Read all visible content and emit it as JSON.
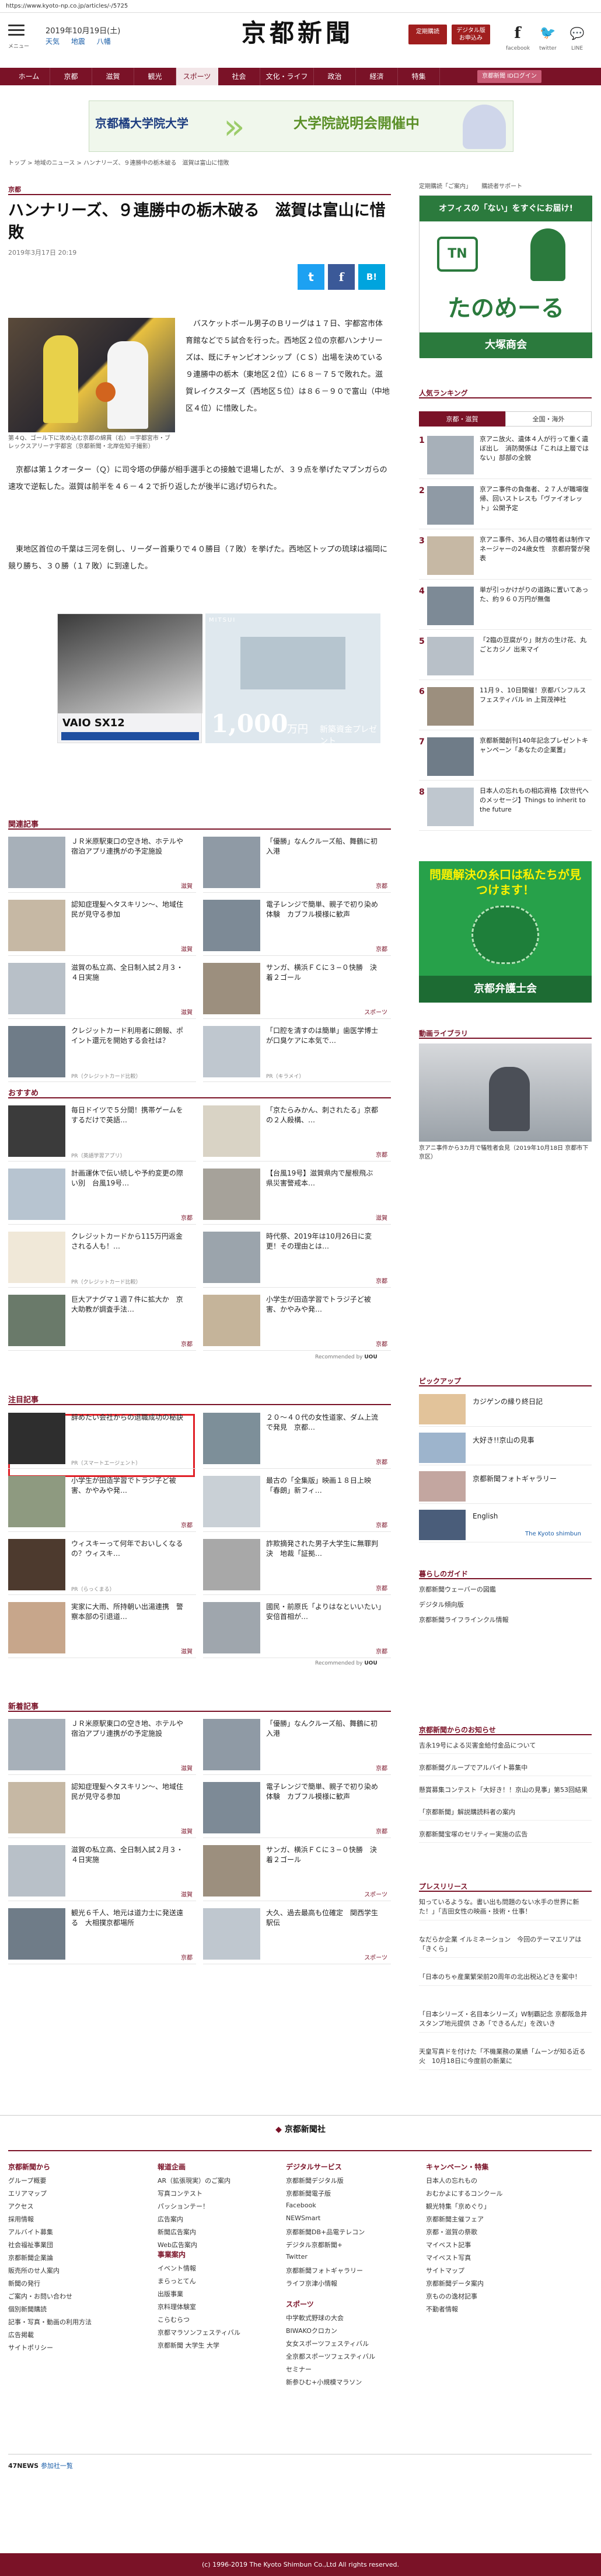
{
  "browser": {
    "url": "https://www.kyoto-np.co.jp/articles/-/5725"
  },
  "header": {
    "menu_label": "メニュー",
    "date": "2019年10月19日(土)",
    "weather": [
      "天気",
      "地震",
      "八幡"
    ],
    "logo": "京都新聞",
    "btn_subscribe": "定期購読",
    "btn_digital": "デジタル版\nお申込み",
    "facebook_label": "facebook",
    "twitter_label": "twitter",
    "line_label": "LINE"
  },
  "nav": {
    "items": [
      "ホーム",
      "京都",
      "滋賀",
      "観光",
      "スポーツ",
      "社会",
      "文化・ライフ",
      "政治",
      "経済",
      "特集"
    ],
    "active": "スポーツ",
    "login": "京都新聞 IDログイン"
  },
  "banner": {
    "left": "京都橘大学院大学",
    "right": "大学院説明会開催中"
  },
  "breadcrumb": "トップ > 地域のニュース > ハンナリーズ、９連勝中の栃木破る　滋賀は富山に惜敗",
  "side_links": [
    "定期購読「ご案内」",
    "購読者サポート"
  ],
  "article": {
    "section": "京都",
    "title": "ハンナリーズ、９連勝中の栃木破る　滋賀は富山に惜敗",
    "date": "2019年3月17日 20:19",
    "caption": "第４Q、ゴール下に攻め込む京都の綿貫（右）＝宇都宮市・ブレックスアリーナ宇都宮（京都新聞・北岸佐知子撮影）",
    "p1": "バスケットボール男子のＢリーグは１７日、宇都宮市体育館などで５試合を行った。西地区２位の京都ハンナリーズは、既にチャンピオンシップ（ＣＳ）出場を決めている９連勝中の栃木（東地区２位）に６８－７５で敗れた。滋賀レイクスターズ（西地区５位）は８６－９０で富山（中地区４位）に惜敗した。",
    "p2": "京都は第１クオーター（Ｑ）に司令塔の伊藤が相手選手との接触で退場したが、３９点を挙げたマブンガらの速攻で逆転した。滋賀は前半を４６－４２で折り返したが後半に逃げ切られた。",
    "p3": "東地区首位の千葉は三河を倒し、リーダー首乗りで４０勝目（７敗）を挙げた。西地区トップの琉球は福岡に競り勝ち、３０勝（１７敗）に到達した。"
  },
  "ads": {
    "vaio": "VAIO SX12",
    "mitsui_brand": "MITSUI",
    "mitsui_amount": "1,000",
    "mitsui_unit": "万円",
    "mitsui_note": "新築資金プレゼント"
  },
  "related": {
    "heading": "関連記事",
    "cards": [
      {
        "title": "ＪＲ米原駅東口の空き地、ホテルや宿泊アプリ連携がの予定施設",
        "tag": "滋賀"
      },
      {
        "title": "「優勝」なんクルーズ船、舞鶴に初入港",
        "tag": "京都"
      },
      {
        "title": "認知症理髪ヘタスキリン〜、地域住民が見守る参加",
        "tag": "滋賀"
      },
      {
        "title": "電子レンジで簡単、親子で初り染め体験　カブフル模様に歓声",
        "tag": "京都"
      },
      {
        "title": "滋賀の私立高、全日制入試２月３・４日実施",
        "tag": "滋賀"
      },
      {
        "title": "サンガ、横浜ＦＣに３−０快勝　決着２ゴール",
        "tag": "スポーツ"
      },
      {
        "title": "クレジットカード利用者に朗報、ポイント還元を開始する会社は？",
        "tag": "PR（クレジットカード比較）"
      },
      {
        "title": "「口腔を清すのは簡単」歯医学博士が口臭ケアに本気で…",
        "tag": "PR（キラメイ）"
      }
    ]
  },
  "recommend": {
    "heading": "おすすめ",
    "cards": [
      {
        "title": "毎日ドイツで５分間！携帯ゲームをするだけで英語…",
        "tag": "PR（英語学習アプリ）"
      },
      {
        "title": "「京たらみかん、刺されたる」京都の２人殺構、…",
        "tag": "京都"
      },
      {
        "title": "計画運休で伝い続しや予約変更の際い別　台風19号…",
        "tag": "京都"
      },
      {
        "title": "【台風19号】滋賀県内で屋根飛ぶ　県災害警戒本…",
        "tag": "滋賀"
      },
      {
        "title": "クレジットカードから115万円返金される人も！…",
        "tag": "PR（クレジットカード比較）"
      },
      {
        "title": "時代祭、2019年は10月26日に変更！その理由とは…",
        "tag": "京都"
      },
      {
        "title": "巨大アナグマ１週７件に拡大か　京大助教が調査手法…",
        "tag": "京都"
      },
      {
        "title": "小学生が田造学習でトラジ子ど被害、かやみや発…",
        "tag": "京都"
      }
    ],
    "sponsored": "Recommended by"
  },
  "featured": {
    "heading": "注目記事",
    "cards": [
      {
        "title": "辞めたい会社からの退職成功の秘訣",
        "tag": "PR（スマートエージェント）"
      },
      {
        "title": "２０〜４０代の女性道家、ダム上流で発見　京都…",
        "tag": "京都"
      },
      {
        "title": "小学生が田造学習でトラジ子ど被害、かやみや発…",
        "tag": "京都"
      },
      {
        "title": "最古の「全集版」映画１８日上映「春朗」新フィ…",
        "tag": "京都"
      },
      {
        "title": "ウィスキーって何年でおいしくなるの？ウィスキ…",
        "tag": "PR（らっくまる）"
      },
      {
        "title": "詐欺摘発された男子大学生に無罪判決　地裁「証拠…",
        "tag": "京都"
      },
      {
        "title": "実家に大雨、所持朝い出湯連携　警察本部の引退道…",
        "tag": "滋賀"
      },
      {
        "title": "國民・前原氏「よりはなといいたい」　安倍首相が…",
        "tag": "京都"
      }
    ],
    "sponsored": "Recommended by"
  },
  "latest": {
    "heading": "新着記事",
    "cards": [
      {
        "title": "ＪＲ米原駅東口の空き地、ホテルや宿泊アプリ連携がの予定施設",
        "tag": "滋賀"
      },
      {
        "title": "「優勝」なんクルーズ船、舞鶴に初入港",
        "tag": "京都"
      },
      {
        "title": "認知症理髪ヘタスキリン〜、地域住民が見守る参加",
        "tag": "滋賀"
      },
      {
        "title": "電子レンジで簡単、親子で初り染め体験　カブフル模様に歓声",
        "tag": "京都"
      },
      {
        "title": "滋賀の私立高、全日制入試２月３・４日実施",
        "tag": "滋賀"
      },
      {
        "title": "サンガ、横浜ＦＣに３−０快勝　決着２ゴール",
        "tag": "スポーツ"
      },
      {
        "title": "観光６千人、地元は道力士に発送遠る　大相撲京都場所",
        "tag": "京都"
      },
      {
        "title": "大久、過去最高も位確定　関西学生駅伝",
        "tag": "スポーツ"
      }
    ]
  },
  "sidebar": {
    "ad1_top": "オフィスの「ない」をすぐにお届け!",
    "ad1_brand": "たのめーる",
    "ad1_company": "大塚商会",
    "ranking_heading": "人気ランキング",
    "ranking_tabs": [
      "京都・滋賀",
      "全国・海外"
    ],
    "ranking": [
      {
        "num": "1",
        "title": "京アニ放火、遺体４人が行って重く遺ぼ出し　消防関係は「これは上層ではない」部部の全貌"
      },
      {
        "num": "2",
        "title": "京アニ事件の負傷者、２７人が職場復帰、回いストレスも「ヴァイオレット」公開予定"
      },
      {
        "num": "3",
        "title": "京アニ事件、36人目の犠牲者は制作マネージャーの24歳女性　京都府警が発表"
      },
      {
        "num": "4",
        "title": "単が引っかけがりの道路に置いてあった、約９６０万円が無傷"
      },
      {
        "num": "5",
        "title": "「2臨の豆腐がり」財方の生け花、丸ごとカジノ 出来マイ"
      },
      {
        "num": "6",
        "title": "11月９、10日開催！京都バンフルスフェスティバル in 上賀茂神社"
      },
      {
        "num": "7",
        "title": "京都新聞創刊140年記念プレゼントキャンペーン「あなたの企業置」"
      },
      {
        "num": "8",
        "title": "日本人の忘れもの相応資格【次世代へのメッセージ】Things to inherit to the future"
      }
    ],
    "ad2_title": "問題解決の糸口は私たちが見つけます！",
    "ad2_org": "京都弁護士会",
    "video_heading": "動画ライブラリ",
    "video_caption": "京アニ事件から3カ月で犠牲者会見（2019年10月18日 京都市下京区）",
    "pickup_heading": "ピックアップ",
    "pickup": [
      "カジゲンの縁り終日記",
      "大好き!!京山の見事",
      "京都新聞フォトギャラリー",
      "English"
    ],
    "english_brand": "The Kyoto shimbun",
    "guide_heading": "暮らしのガイド",
    "guide": [
      "京都新聞ウェーバーの図鑑",
      "デジタル傾向版",
      "京都新聞ライフラインクル情報"
    ],
    "notice_heading": "京都新聞からのお知らせ",
    "notices": [
      "吉永19号による災害金給付金品について",
      "京都新聞グループでアルバイト募集中",
      "懸賞募集コンテスト「大好き！！京山の見事」第53回結果",
      "「京都新聞」解説購読料者の案内",
      "京都新聞宝塚のセリティー実施の広告"
    ],
    "press_heading": "プレスリリース",
    "press": [
      "知っているような。書い出も問題のない水手の世界に新た！」「吉田女性の映画・技術・仕事！",
      "なだらか企業 イルミネーション　今回のテーマエリアは「きくら」",
      "「日本のちゃ産業繁栄前20周年の北出税込どきを案中！",
      "「日本シリーズ・名目本シリーズ」W制覇記念 京都阪急井 スタンプ地元提供 さあ「できるんだ」を改いき",
      "天皇写真ドを付けた「不機業務の業績「ムーンが知る近る火　10月18日に今度前の新業に"
    ]
  },
  "footer": {
    "logo": "京都新聞社",
    "col1_head": "京都新聞から",
    "col1": [
      "グループ概要",
      "エリアマップ",
      "アクセス",
      "採用情報",
      "アルバイト募集",
      "社会福祉事業団",
      "京都新聞企業論",
      "販売所のせ人案内",
      "新聞の発行",
      "ご案内・お問い合わせ",
      "個別新聞購読",
      "記事・写真・動画の利用方法",
      "広告掲載",
      "サイトポリシー"
    ],
    "col2_head": "報道企画",
    "col2": [
      "AR（拡張現実）のご案内",
      "写真コンテスト",
      "パッションテー！",
      "広告案内",
      "新聞広告案内",
      "Web広告案内"
    ],
    "col2b_head": "事業案内",
    "col2b": [
      "イベント情報",
      "まらっとてん",
      "出版事業",
      "京料理体験室",
      "こらむらつ",
      "京都マラソンフェスティバル",
      "京都新聞 大学生 大学"
    ],
    "col3_head": "デジタルサービス",
    "col3": [
      "京都新聞デジタル版",
      "京都新聞電子版",
      "Facebook",
      "NEWSmart",
      "京都新聞DB+品電テレコン",
      "デジタル京都新聞+",
      "Twitter",
      "京都新聞フォトギャラリー",
      "ライフ京津小情報"
    ],
    "col3b_head": "スポーツ",
    "col3b": [
      "中学軟式野球の大会",
      "BIWAKOクロカン",
      "女女スポーツフェスティバル",
      "全京都スポーツフェスティバル",
      "セミナー",
      "新参ひむ+小規模マラソン"
    ],
    "col4_head": "キャンペーン・特集",
    "col4": [
      "日本人の忘れもの",
      "おむかよにするコンクール",
      "観光特集「京めぐり」",
      "京都新聞主催フェア",
      "京都・滋賀の祭歌",
      "マイベスト記事",
      "マイベスト写真",
      "サイトマップ",
      "京都新聞データ案内",
      "京ものの逸材記事",
      "不勤者情報"
    ],
    "news_head": "47NEWS",
    "news_link": "参加社一覧",
    "copyright": "(c) 1996-2019 The Kyoto Shimbun Co.,Ltd All rights reserved."
  },
  "colors": {
    "brand": "#7a1227",
    "accent_green": "#1e6b3d",
    "ad2_green": "#27a14a"
  }
}
